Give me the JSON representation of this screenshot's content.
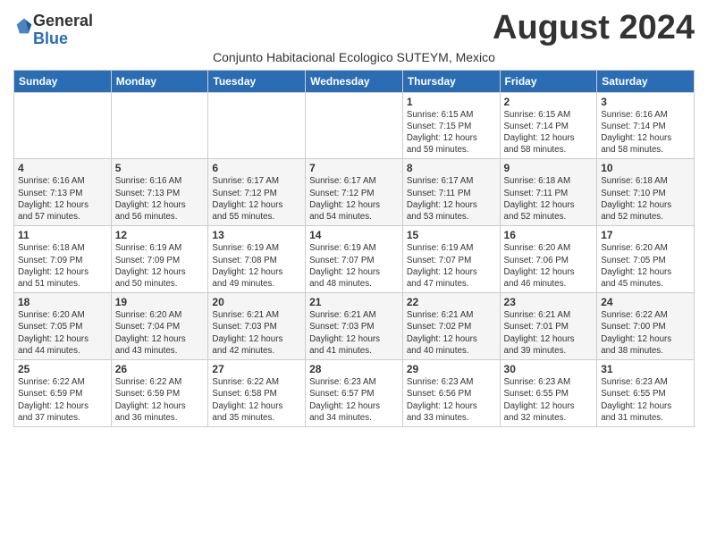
{
  "logo": {
    "general": "General",
    "blue": "Blue"
  },
  "title": "August 2024",
  "subtitle": "Conjunto Habitacional Ecologico SUTEYM, Mexico",
  "days_header": [
    "Sunday",
    "Monday",
    "Tuesday",
    "Wednesday",
    "Thursday",
    "Friday",
    "Saturday"
  ],
  "weeks": [
    [
      {
        "day": "",
        "info": ""
      },
      {
        "day": "",
        "info": ""
      },
      {
        "day": "",
        "info": ""
      },
      {
        "day": "",
        "info": ""
      },
      {
        "day": "1",
        "info": "Sunrise: 6:15 AM\nSunset: 7:15 PM\nDaylight: 12 hours\nand 59 minutes."
      },
      {
        "day": "2",
        "info": "Sunrise: 6:15 AM\nSunset: 7:14 PM\nDaylight: 12 hours\nand 58 minutes."
      },
      {
        "day": "3",
        "info": "Sunrise: 6:16 AM\nSunset: 7:14 PM\nDaylight: 12 hours\nand 58 minutes."
      }
    ],
    [
      {
        "day": "4",
        "info": "Sunrise: 6:16 AM\nSunset: 7:13 PM\nDaylight: 12 hours\nand 57 minutes."
      },
      {
        "day": "5",
        "info": "Sunrise: 6:16 AM\nSunset: 7:13 PM\nDaylight: 12 hours\nand 56 minutes."
      },
      {
        "day": "6",
        "info": "Sunrise: 6:17 AM\nSunset: 7:12 PM\nDaylight: 12 hours\nand 55 minutes."
      },
      {
        "day": "7",
        "info": "Sunrise: 6:17 AM\nSunset: 7:12 PM\nDaylight: 12 hours\nand 54 minutes."
      },
      {
        "day": "8",
        "info": "Sunrise: 6:17 AM\nSunset: 7:11 PM\nDaylight: 12 hours\nand 53 minutes."
      },
      {
        "day": "9",
        "info": "Sunrise: 6:18 AM\nSunset: 7:11 PM\nDaylight: 12 hours\nand 52 minutes."
      },
      {
        "day": "10",
        "info": "Sunrise: 6:18 AM\nSunset: 7:10 PM\nDaylight: 12 hours\nand 52 minutes."
      }
    ],
    [
      {
        "day": "11",
        "info": "Sunrise: 6:18 AM\nSunset: 7:09 PM\nDaylight: 12 hours\nand 51 minutes."
      },
      {
        "day": "12",
        "info": "Sunrise: 6:19 AM\nSunset: 7:09 PM\nDaylight: 12 hours\nand 50 minutes."
      },
      {
        "day": "13",
        "info": "Sunrise: 6:19 AM\nSunset: 7:08 PM\nDaylight: 12 hours\nand 49 minutes."
      },
      {
        "day": "14",
        "info": "Sunrise: 6:19 AM\nSunset: 7:07 PM\nDaylight: 12 hours\nand 48 minutes."
      },
      {
        "day": "15",
        "info": "Sunrise: 6:19 AM\nSunset: 7:07 PM\nDaylight: 12 hours\nand 47 minutes."
      },
      {
        "day": "16",
        "info": "Sunrise: 6:20 AM\nSunset: 7:06 PM\nDaylight: 12 hours\nand 46 minutes."
      },
      {
        "day": "17",
        "info": "Sunrise: 6:20 AM\nSunset: 7:05 PM\nDaylight: 12 hours\nand 45 minutes."
      }
    ],
    [
      {
        "day": "18",
        "info": "Sunrise: 6:20 AM\nSunset: 7:05 PM\nDaylight: 12 hours\nand 44 minutes."
      },
      {
        "day": "19",
        "info": "Sunrise: 6:20 AM\nSunset: 7:04 PM\nDaylight: 12 hours\nand 43 minutes."
      },
      {
        "day": "20",
        "info": "Sunrise: 6:21 AM\nSunset: 7:03 PM\nDaylight: 12 hours\nand 42 minutes."
      },
      {
        "day": "21",
        "info": "Sunrise: 6:21 AM\nSunset: 7:03 PM\nDaylight: 12 hours\nand 41 minutes."
      },
      {
        "day": "22",
        "info": "Sunrise: 6:21 AM\nSunset: 7:02 PM\nDaylight: 12 hours\nand 40 minutes."
      },
      {
        "day": "23",
        "info": "Sunrise: 6:21 AM\nSunset: 7:01 PM\nDaylight: 12 hours\nand 39 minutes."
      },
      {
        "day": "24",
        "info": "Sunrise: 6:22 AM\nSunset: 7:00 PM\nDaylight: 12 hours\nand 38 minutes."
      }
    ],
    [
      {
        "day": "25",
        "info": "Sunrise: 6:22 AM\nSunset: 6:59 PM\nDaylight: 12 hours\nand 37 minutes."
      },
      {
        "day": "26",
        "info": "Sunrise: 6:22 AM\nSunset: 6:59 PM\nDaylight: 12 hours\nand 36 minutes."
      },
      {
        "day": "27",
        "info": "Sunrise: 6:22 AM\nSunset: 6:58 PM\nDaylight: 12 hours\nand 35 minutes."
      },
      {
        "day": "28",
        "info": "Sunrise: 6:23 AM\nSunset: 6:57 PM\nDaylight: 12 hours\nand 34 minutes."
      },
      {
        "day": "29",
        "info": "Sunrise: 6:23 AM\nSunset: 6:56 PM\nDaylight: 12 hours\nand 33 minutes."
      },
      {
        "day": "30",
        "info": "Sunrise: 6:23 AM\nSunset: 6:55 PM\nDaylight: 12 hours\nand 32 minutes."
      },
      {
        "day": "31",
        "info": "Sunrise: 6:23 AM\nSunset: 6:55 PM\nDaylight: 12 hours\nand 31 minutes."
      }
    ]
  ]
}
